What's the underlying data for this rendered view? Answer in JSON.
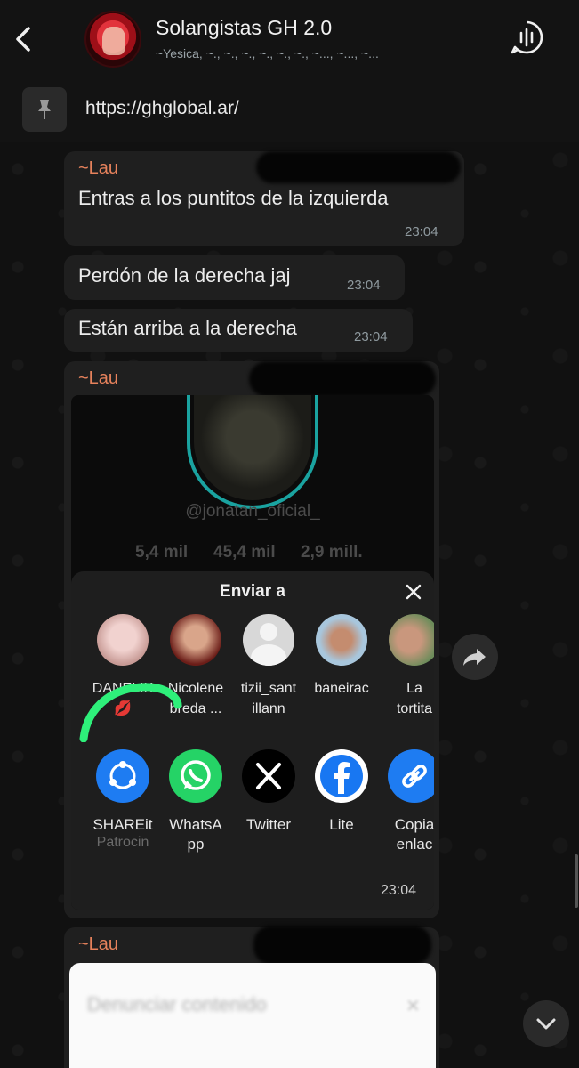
{
  "header": {
    "title": "Solangistas GH 2.0",
    "members": "~Yesica, ~., ~., ~., ~., ~., ~., ~..., ~..., ~..."
  },
  "pinned": {
    "text": "https://ghglobal.ar/"
  },
  "messages": [
    {
      "sender": "~Lau",
      "text": "Entras a los puntitos de la izquierda",
      "time": "23:04"
    },
    {
      "text": "Perdón de la derecha jaj",
      "time": "23:04"
    },
    {
      "text": "Están arriba a la derecha",
      "time": "23:04"
    },
    {
      "sender": "~Lau",
      "time": "23:04"
    },
    {
      "sender": "~Lau"
    }
  ],
  "screenshot": {
    "handle": "@jonatan_oficial_",
    "stats": [
      "5,4 mil",
      "45,4 mil",
      "2,9 mill."
    ],
    "sheet_title": "Enviar a",
    "contacts": [
      {
        "name": "DANELIK\n💋",
        "color": "#d9b3b0"
      },
      {
        "name": "Nicolene\nbreda ...",
        "color": "#b0443c"
      },
      {
        "name": "tizii_sant\nillann",
        "color": "#d0d0d0"
      },
      {
        "name": "baneirac",
        "color": "#7aa4c4"
      },
      {
        "name": "La\ntortita",
        "color": "#9a8a6a"
      }
    ],
    "apps": [
      {
        "label": "SHAREit",
        "sub": "Patrocin",
        "color": "#1e7cf2"
      },
      {
        "label": "WhatsA\npp",
        "sub": "",
        "color": "#25d366"
      },
      {
        "label": "Twitter",
        "sub": "",
        "color": "#000000"
      },
      {
        "label": "Lite",
        "sub": "",
        "color": "#ffffff"
      },
      {
        "label": "Copia\nenlac",
        "sub": "",
        "color": "#1e7cf2"
      }
    ],
    "report_text": "Denunciar contenido"
  },
  "colors": {
    "sender": "#e7825c",
    "bubble": "#1f1f1f",
    "accent_teal": "#1aa3a0",
    "scribble": "#2ef07a"
  }
}
